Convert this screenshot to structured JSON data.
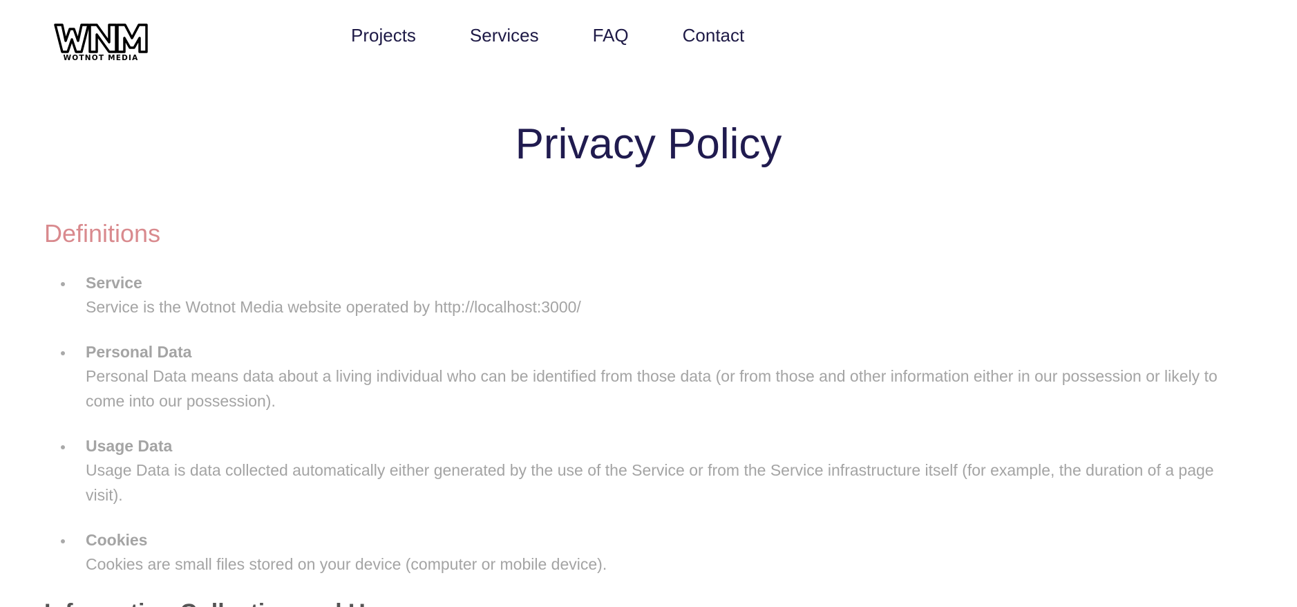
{
  "brand": {
    "logo_text": "WNM",
    "logo_subtext": "WOTNOT MEDIA"
  },
  "nav": {
    "items": [
      {
        "label": "Projects"
      },
      {
        "label": "Services"
      },
      {
        "label": "FAQ"
      },
      {
        "label": "Contact"
      }
    ]
  },
  "page": {
    "title": "Privacy Policy"
  },
  "definitions": {
    "heading": "Definitions",
    "items": [
      {
        "term": "Service",
        "description": "Service is the Wotnot Media website operated by http://localhost:3000/"
      },
      {
        "term": "Personal Data",
        "description": "Personal Data means data about a living individual who can be identified from those data (or from those and other information either in our possession or likely to come into our possession)."
      },
      {
        "term": "Usage Data",
        "description": "Usage Data is data collected automatically either generated by the use of the Service or from the Service infrastructure itself (for example, the duration of a page visit)."
      },
      {
        "term": "Cookies",
        "description": "Cookies are small files stored on your device (computer or mobile device)."
      }
    ]
  },
  "next_section": {
    "heading": "Information Collection and Use"
  },
  "colors": {
    "nav_text": "#1e1a46",
    "title": "#201b4f",
    "section_heading": "#d98a8e",
    "body_text": "#a4a4a4"
  }
}
